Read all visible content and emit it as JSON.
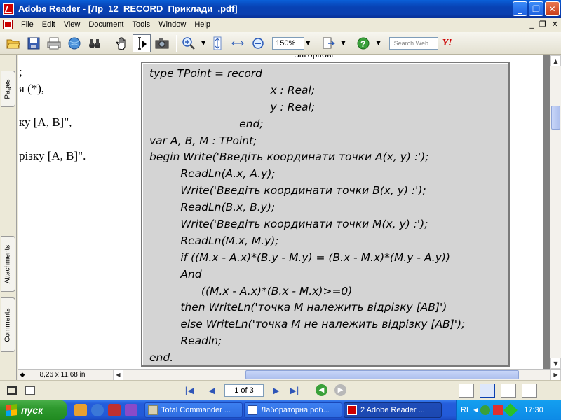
{
  "window": {
    "title": "Adobe Reader - [Лр_12_RECORD_Приклади_.pdf]"
  },
  "menubar": {
    "items": [
      "File",
      "Edit",
      "View",
      "Document",
      "Tools",
      "Window",
      "Help"
    ]
  },
  "toolbar": {
    "zoom_value": "150%",
    "search_placeholder": "Search Web"
  },
  "left_panel": {
    "tabs": [
      "Pages",
      "Attachments",
      "Comments"
    ]
  },
  "document": {
    "partial_lines": [
      ";",
      "я (*),",
      "",
      "ку [A, B]\",",
      "",
      "різку [A, B]\"."
    ],
    "cropped_header": "Загорабы",
    "code_lines": [
      "type TPoint = record",
      "                                   x : Real;",
      "                                   y : Real;",
      "                          end;",
      "var A, B, M : TPoint;",
      "begin Write('Введіть координати точки A(x, y) :');",
      "         ReadLn(A.x, A.y);",
      "         Write('Введіть координати точки B(x, y) :');",
      "         ReadLn(B.x, B.y);",
      "         Write('Введіть координати точки M(x, y) :');",
      "         ReadLn(M.x, M.y);",
      "         if ((M.x - A.x)*(B.y - M.y) = (B.x - M.x)*(M.y - A.y))",
      "         And",
      "               ((M.x - A.x)*(B.x - M.x)>=0)",
      "         then WriteLn('точка M належить відрізку [AB]')",
      "         else WriteLn('точка M не належить відрізку [AB]');",
      "         Readln;",
      "end."
    ]
  },
  "statusbar": {
    "page_size": "8,26 x 11,68 in",
    "page_indicator": "1 of 3"
  },
  "taskbar": {
    "start_label": "пуск",
    "tasks": [
      "Total Commander ...",
      "Лабораторна роб...",
      "2 Adobe Reader ..."
    ],
    "language": "RL",
    "clock": "17:30"
  },
  "colors": {
    "titlebar": "#0a45c0",
    "code_box_bg": "#d4d4d4",
    "doc_bg": "#808080",
    "taskbar": "#245ddb",
    "start_button": "#2f9a2f"
  }
}
